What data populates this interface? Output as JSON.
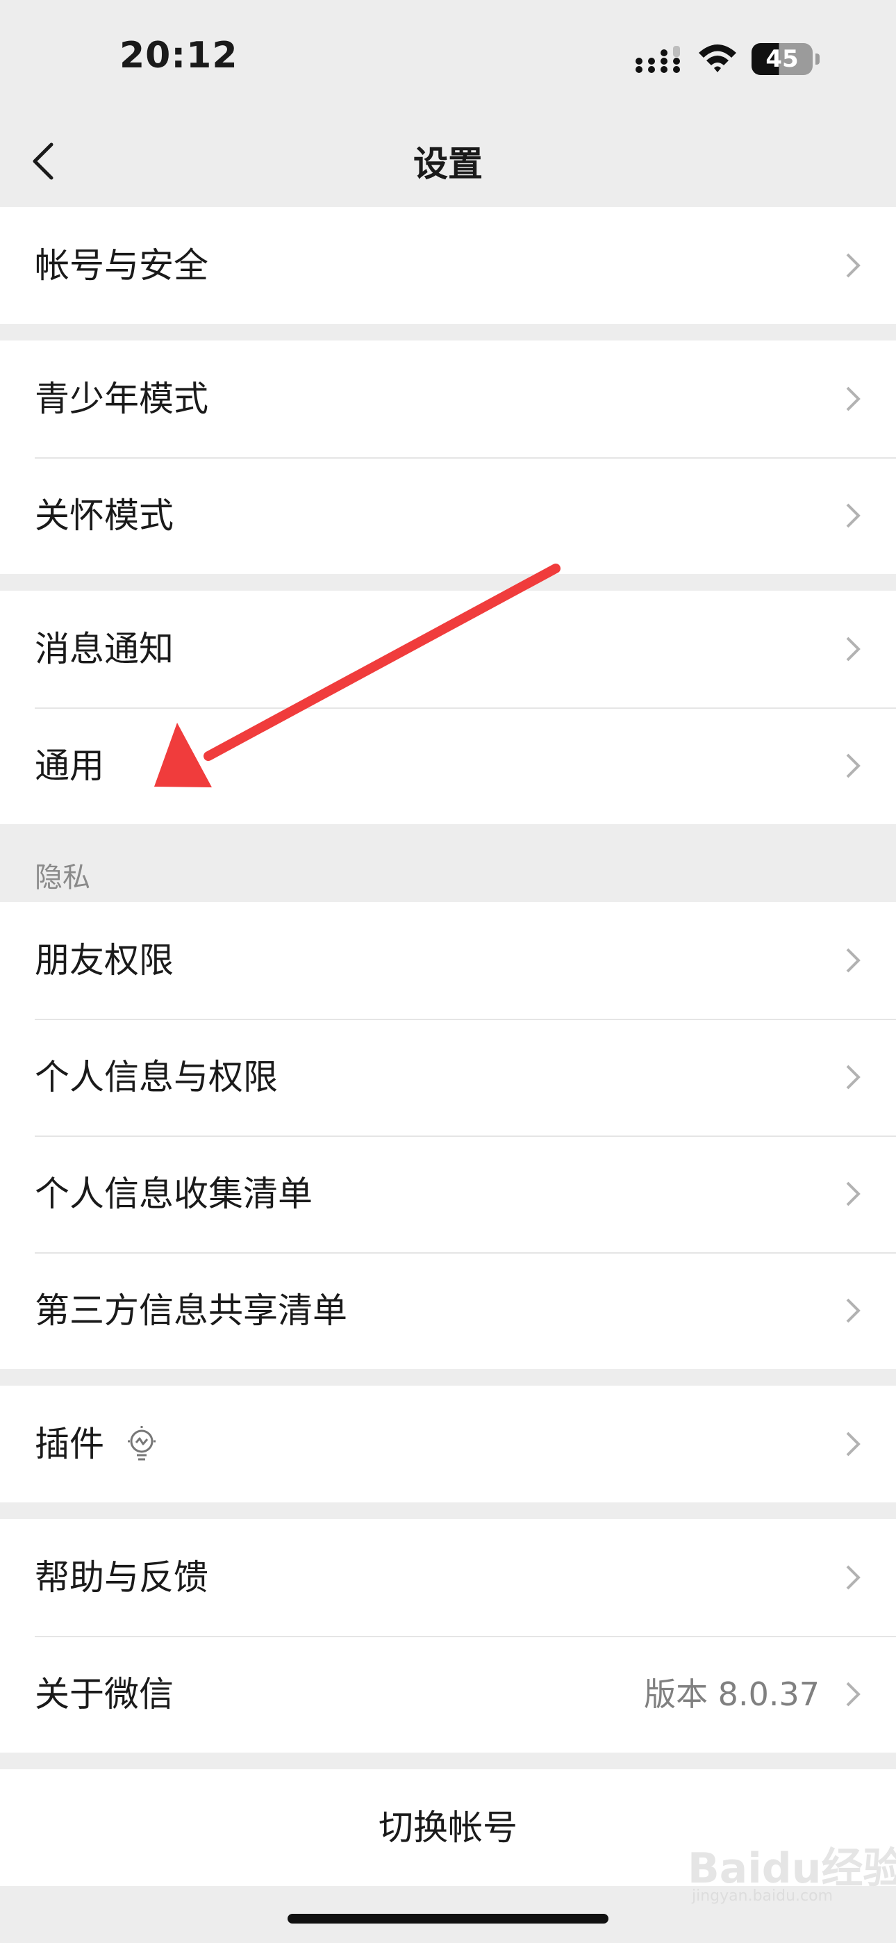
{
  "status_bar": {
    "time": "20:12",
    "battery": "45",
    "icons": [
      "signal-icon",
      "wifi-icon",
      "battery-icon"
    ]
  },
  "nav": {
    "title": "设置",
    "back_icon": "chevron-left-icon"
  },
  "groups": [
    {
      "items": [
        {
          "label": "帐号与安全"
        }
      ]
    },
    {
      "items": [
        {
          "label": "青少年模式"
        },
        {
          "label": "关怀模式"
        }
      ]
    },
    {
      "items": [
        {
          "label": "消息通知"
        },
        {
          "label": "通用"
        }
      ]
    },
    {
      "header": "隐私",
      "items": [
        {
          "label": "朋友权限"
        },
        {
          "label": "个人信息与权限"
        },
        {
          "label": "个人信息收集清单"
        },
        {
          "label": "第三方信息共享清单"
        }
      ]
    },
    {
      "items": [
        {
          "label": "插件",
          "icon": "lightbulb-icon"
        }
      ]
    },
    {
      "items": [
        {
          "label": "帮助与反馈"
        },
        {
          "label": "关于微信",
          "value": "版本 8.0.37"
        }
      ]
    }
  ],
  "switch_account": "切换帐号",
  "watermark": {
    "text": "Baidu经验",
    "sub": "jingyan.baidu.com"
  },
  "colors": {
    "background": "#ededed",
    "annotation_arrow": "#f03c3c",
    "secondary_text": "#808080"
  }
}
